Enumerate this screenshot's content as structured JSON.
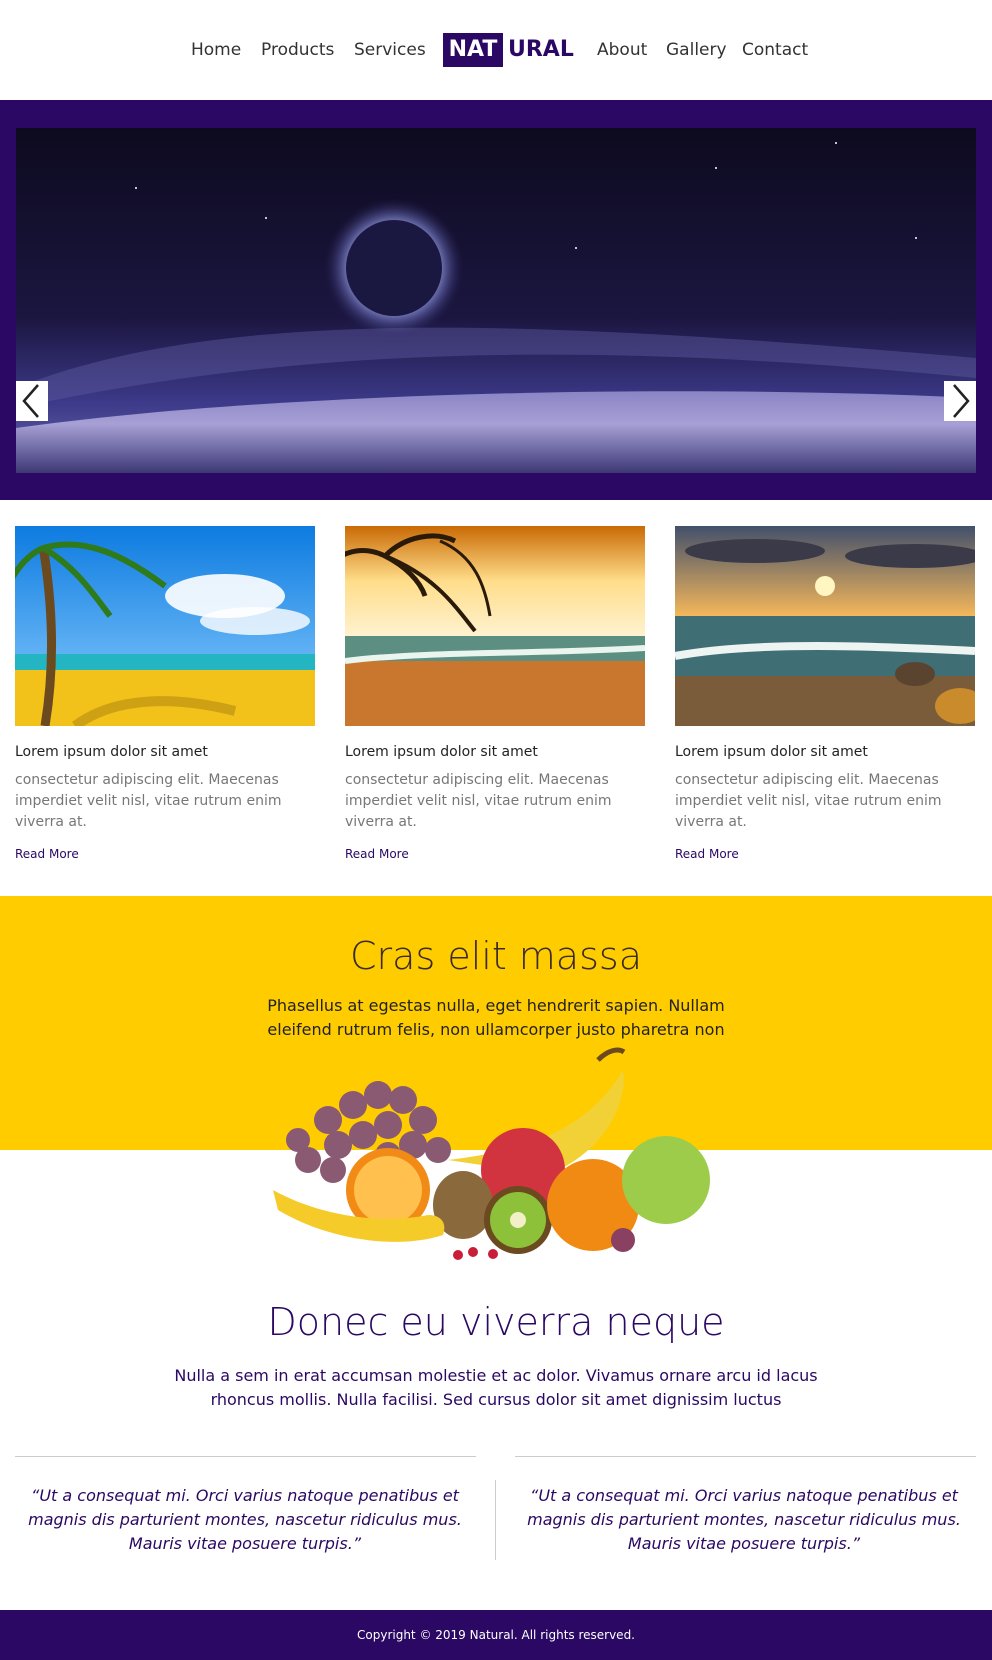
{
  "nav": {
    "items": [
      "Home",
      "Products",
      "Services",
      "About",
      "Gallery",
      "Contact"
    ],
    "logo_part1": "NAT",
    "logo_part2": "URAL"
  },
  "hero": {
    "prev_icon": "chevron-left-icon",
    "next_icon": "chevron-right-icon"
  },
  "cards": [
    {
      "title": "Lorem ipsum dolor sit amet",
      "desc": "consectetur adipiscing elit. Maecenas imperdiet velit nisl, vitae rutrum enim viverra at.",
      "link": "Read More"
    },
    {
      "title": "Lorem ipsum dolor sit amet",
      "desc": "consectetur adipiscing elit. Maecenas imperdiet velit nisl, vitae rutrum enim viverra at.",
      "link": "Read More"
    },
    {
      "title": "Lorem ipsum dolor sit amet",
      "desc": "consectetur adipiscing elit. Maecenas imperdiet velit nisl, vitae rutrum enim viverra at.",
      "link": "Read More"
    }
  ],
  "band": {
    "title": "Cras elit massa",
    "text": "Phasellus at egestas nulla, eget hendrerit sapien. Nullam eleifend rutrum felis, non ullamcorper justo pharetra non"
  },
  "section2": {
    "title": "Donec eu viverra neque",
    "text": "Nulla a sem in erat accumsan molestie et ac dolor. Vivamus ornare arcu id lacus rhoncus mollis. Nulla facilisi. Sed cursus dolor sit amet dignissim luctus"
  },
  "quotes": [
    "“Ut a consequat mi. Orci varius natoque penatibus et magnis dis parturient montes, nascetur ridiculus mus. Mauris vitae posuere turpis.”",
    "“Ut a consequat mi. Orci varius natoque penatibus et magnis dis parturient montes, nascetur ridiculus mus. Mauris vitae posuere turpis.”"
  ],
  "footer": {
    "copyright": "Copyright © 2019 Natural. All rights reserved."
  },
  "colors": {
    "brand": "#2a0863",
    "accent": "#ffcc00"
  }
}
